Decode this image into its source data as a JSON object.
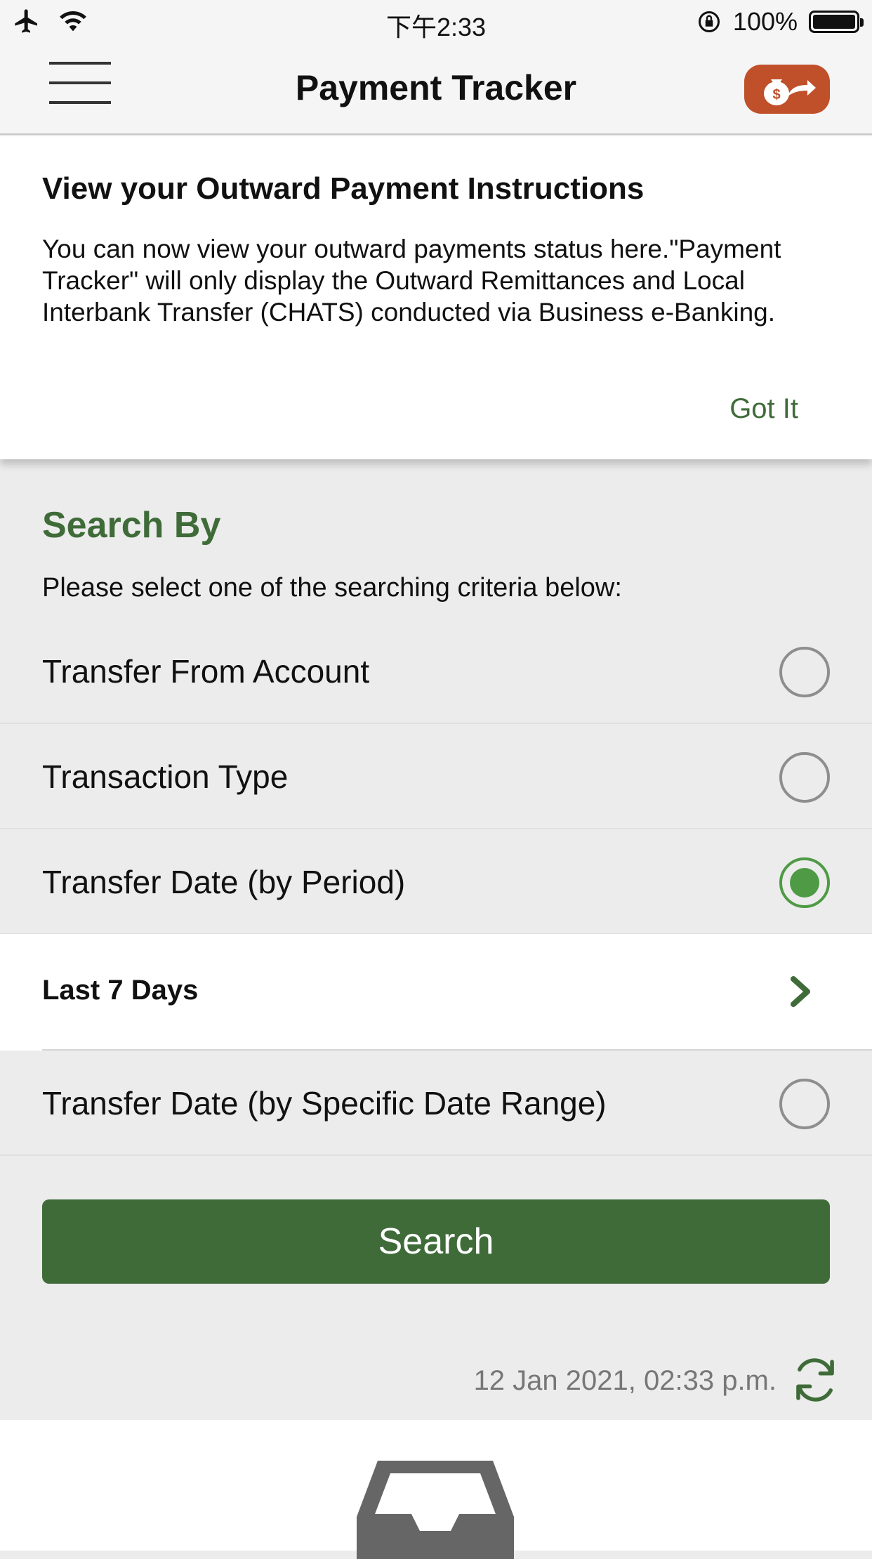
{
  "status_bar": {
    "time": "下午2:33",
    "battery": "100%",
    "icons": [
      "airplane-icon",
      "wifi-icon",
      "rotation-lock-icon",
      "battery-icon"
    ]
  },
  "nav": {
    "title": "Payment Tracker",
    "menu_icon": "hamburger-icon",
    "action_icon": "money-bag-arrow-icon",
    "action_color": "#c0502a"
  },
  "info": {
    "title": "View your Outward Payment Instructions",
    "body": "You can now view your outward payments status here.\"Payment Tracker\" will only display the Outward Remittances and Local Interbank Transfer (CHATS)  conducted via Business e-Banking.",
    "got_it": "Got It"
  },
  "search": {
    "heading": "Search By",
    "subtitle": "Please select one of the searching criteria below:",
    "options": [
      {
        "label": "Transfer From Account",
        "selected": false
      },
      {
        "label": "Transaction Type",
        "selected": false
      },
      {
        "label": "Transfer Date (by Period)",
        "selected": true
      },
      {
        "label": "Transfer Date (by Specific Date Range)",
        "selected": false
      }
    ],
    "period_value": "Last 7 Days",
    "button": "Search",
    "timestamp": "12 Jan 2021, 02:33 p.m."
  },
  "colors": {
    "accent_green": "#3f6b39",
    "radio_green": "#4f9a45",
    "background": "#ececec"
  }
}
